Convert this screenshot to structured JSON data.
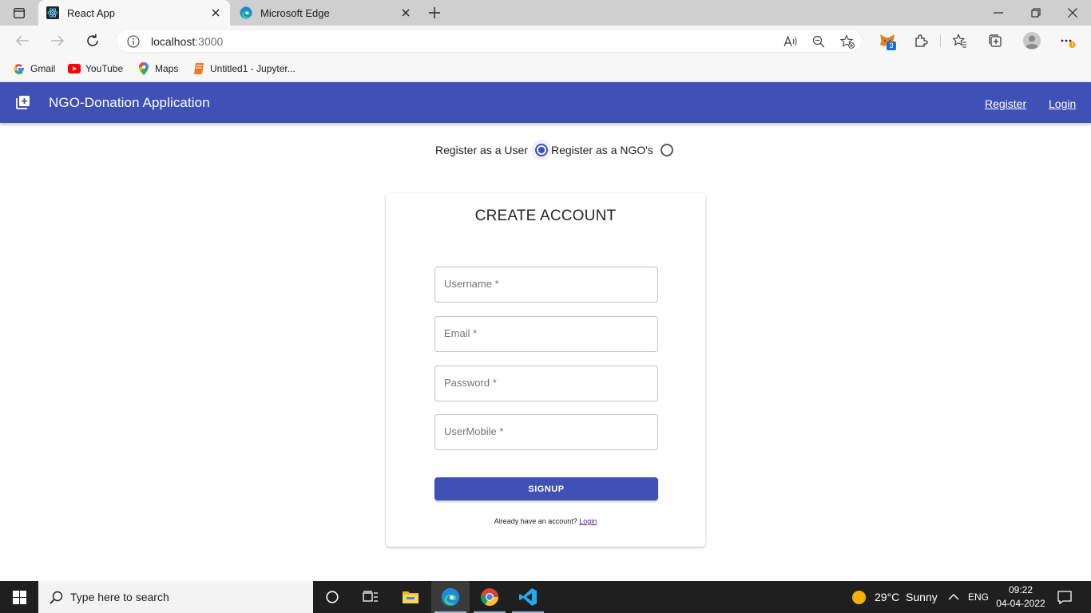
{
  "browser": {
    "tabs": [
      {
        "title": "React App",
        "active": true
      },
      {
        "title": "Microsoft Edge",
        "active": false
      }
    ],
    "url": {
      "host": "localhost",
      "port": ":3000"
    },
    "extension_badge": "3",
    "bookmarks": [
      {
        "label": "Gmail",
        "icon": "gmail-icon"
      },
      {
        "label": "YouTube",
        "icon": "youtube-icon"
      },
      {
        "label": "Maps",
        "icon": "maps-icon"
      },
      {
        "label": "Untitled1 - Jupyter...",
        "icon": "jupyter-icon"
      }
    ]
  },
  "appbar": {
    "title": "NGO-Donation Application",
    "nav": {
      "register": "Register",
      "login": "Login"
    },
    "color": "#3f51b5"
  },
  "role": {
    "user_label": "Register as a User",
    "ngo_label": "Register as a NGO's",
    "selected": "user"
  },
  "form": {
    "title": "CREATE ACCOUNT",
    "fields": {
      "username": "Username *",
      "email": "Email *",
      "password": "Password *",
      "mobile": "UserMobile *"
    },
    "submit_label": "SIGNUP",
    "footer_text": "Already have an account?",
    "footer_link": "Login"
  },
  "taskbar": {
    "search_placeholder": "Type here to search",
    "weather": "29°C  Sunny",
    "language": "ENG",
    "time": "09:22",
    "date": "04-04-2022"
  }
}
